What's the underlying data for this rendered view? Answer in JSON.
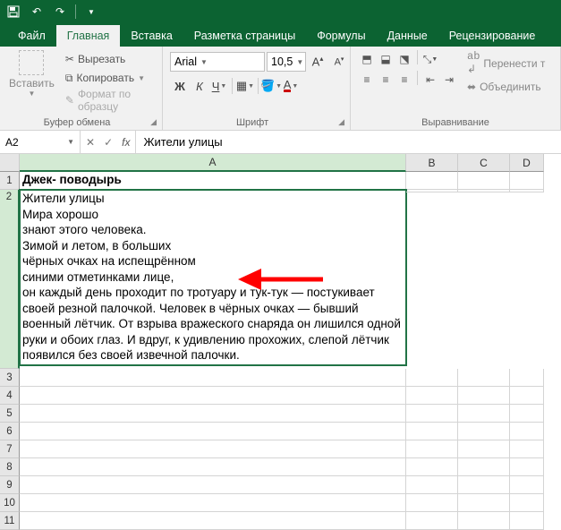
{
  "qat": {
    "undo_tip": "↶",
    "redo_tip": "↷"
  },
  "tabs": {
    "file": "Файл",
    "home": "Главная",
    "insert": "Вставка",
    "layout": "Разметка страницы",
    "formulas": "Формулы",
    "data": "Данные",
    "review": "Рецензирование"
  },
  "ribbon": {
    "clipboard": {
      "paste": "Вставить",
      "cut": "Вырезать",
      "copy": "Копировать",
      "format_painter": "Формат по образцу",
      "group_label": "Буфер обмена"
    },
    "font": {
      "name_value": "Arial",
      "size_value": "10,5",
      "group_label": "Шрифт",
      "bold": "Ж",
      "italic": "К",
      "underline": "Ч"
    },
    "alignment": {
      "wrap": "Перенести т",
      "merge": "Объединить",
      "group_label": "Выравнивание"
    }
  },
  "formula": {
    "name_box": "A2",
    "bar_value": "Жители улицы"
  },
  "columns": {
    "A": "A",
    "B": "B",
    "C": "C",
    "D": "D"
  },
  "rows": [
    "1",
    "2",
    "3",
    "4",
    "5",
    "6",
    "7",
    "8",
    "9",
    "10",
    "11"
  ],
  "cells": {
    "A1": "Джек- поводырь",
    "A2": "Жители улицы\nМира хорошо\nзнают этого человека.\nЗимой и летом, в больших\nчёрных очках на испещрённом\nсиними отметинками лице,\nон каждый день проходит по тротуару и тук-тук — постукивает своей резной палочкой. Человек в чёрных очках — бывший военный лётчик. От взрыва вражеского снаряда он лишился одной руки и обоих глаз. И вдруг, к удивлению прохожих, слепой лётчик появился без своей извечной палочки."
  },
  "chart_data": null,
  "colors": {
    "accent": "#217346",
    "arrow": "#ff0000"
  }
}
